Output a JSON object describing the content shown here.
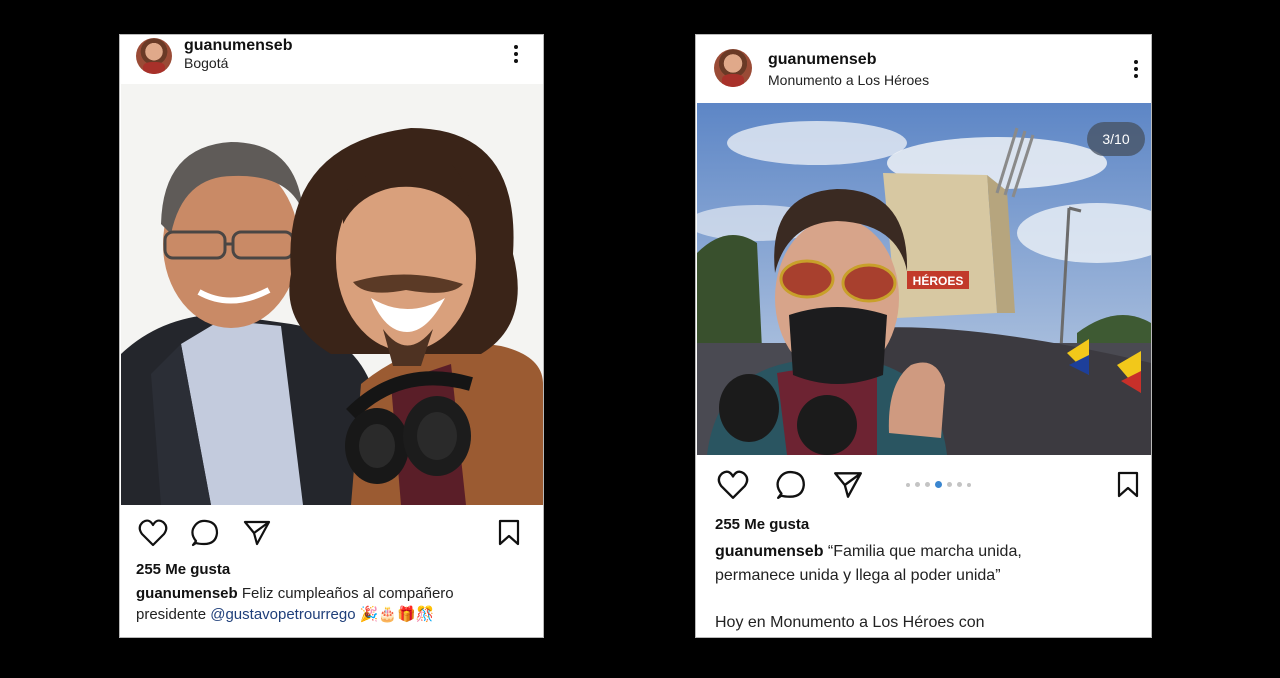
{
  "post1": {
    "username": "guanumenseb",
    "location": "Bogotá",
    "likes": "255 Me gusta",
    "caption_user": "guanumenseb",
    "caption_text": "Feliz cumpleaños al compañero",
    "caption_line2": "presidente",
    "mention": "@gustavopetrourrego",
    "emojis": "🎉🎂🎁🎊"
  },
  "post2": {
    "username": "guanumenseb",
    "location": "Monumento a Los Héroes",
    "counter": "3/10",
    "likes": "255 Me gusta",
    "caption_user": "guanumenseb",
    "caption_text": "“Familia que marcha unida,",
    "caption_line2": "permanece unida y llega al poder unida”",
    "caption_line3": "Hoy en Monumento a Los Héroes con",
    "carousel": {
      "current": 3,
      "total": 10
    },
    "monument_sign": "HÉROES"
  },
  "colors": {
    "active_dot": "#3a86d0",
    "mention": "#1f3f7a",
    "background": "#000000"
  }
}
